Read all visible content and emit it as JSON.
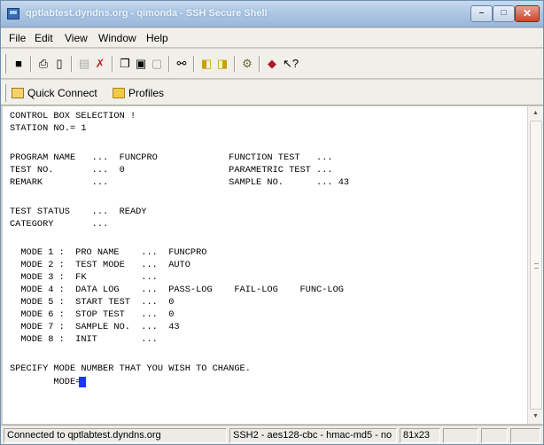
{
  "window": {
    "title": "qptlabtest.dyndns.org - qimonda - SSH Secure Shell",
    "min_glyph": "–",
    "max_glyph": "□",
    "close_glyph": "✕"
  },
  "menu": [
    {
      "name": "file",
      "label": "File"
    },
    {
      "name": "edit",
      "label": "Edit"
    },
    {
      "name": "view",
      "label": "View"
    },
    {
      "name": "window",
      "label": "Window"
    },
    {
      "name": "help",
      "label": "Help"
    }
  ],
  "toolbar": {
    "buttons": [
      {
        "name": "save-icon",
        "glyph": "■"
      },
      {
        "name": "print-icon",
        "glyph": "⎙"
      },
      {
        "name": "print-preview-icon",
        "glyph": "▯"
      },
      {
        "name": "new-terminal-icon",
        "glyph": "▤"
      },
      {
        "name": "disconnect-icon",
        "glyph": "✗"
      },
      {
        "name": "copy-icon",
        "glyph": "❐"
      },
      {
        "name": "paste-icon",
        "glyph": "▣"
      },
      {
        "name": "paste-alt-icon",
        "glyph": "▢"
      },
      {
        "name": "find-icon",
        "glyph": "⚯"
      },
      {
        "name": "profile-icon",
        "glyph": "◧"
      },
      {
        "name": "profile-settings-icon",
        "glyph": "◨"
      },
      {
        "name": "settings-icon",
        "glyph": "⚙"
      },
      {
        "name": "help-book-icon",
        "glyph": "◆"
      },
      {
        "name": "context-help-icon",
        "glyph": "↖?"
      }
    ]
  },
  "quickbar": {
    "quick_connect": "Quick Connect",
    "profiles": "Profiles"
  },
  "terminal": {
    "lines": [
      "CONTROL BOX SELECTION !",
      "STATION NO.= 1",
      "",
      "PROGRAM NAME   ...  FUNCPRO             FUNCTION TEST   ...",
      "TEST NO.       ...  0                   PARAMETRIC TEST ...",
      "REMARK         ...                      SAMPLE NO.      ... 43",
      "",
      "TEST STATUS    ...  READY",
      "CATEGORY       ...",
      "",
      "  MODE 1 :  PRO NAME    ...  FUNCPRO",
      "  MODE 2 :  TEST MODE   ...  AUTO",
      "  MODE 3 :  FK          ...",
      "  MODE 4 :  DATA LOG    ...  PASS-LOG    FAIL-LOG    FUNC-LOG",
      "  MODE 5 :  START TEST  ...  0",
      "  MODE 6 :  STOP TEST   ...  0",
      "  MODE 7 :  SAMPLE NO.  ...  43",
      "  MODE 8 :  INIT        ...",
      "",
      "SPECIFY MODE NUMBER THAT YOU WISH TO CHANGE.",
      "        MODE="
    ],
    "cursor_color": "#1a35ff"
  },
  "scrollbar": {
    "up_glyph": "▲",
    "down_glyph": "▼"
  },
  "status": {
    "connection": "Connected to qptlabtest.dyndns.org",
    "cipher": "SSH2 - aes128-cbc - hmac-md5 - no",
    "size": "81x23"
  }
}
